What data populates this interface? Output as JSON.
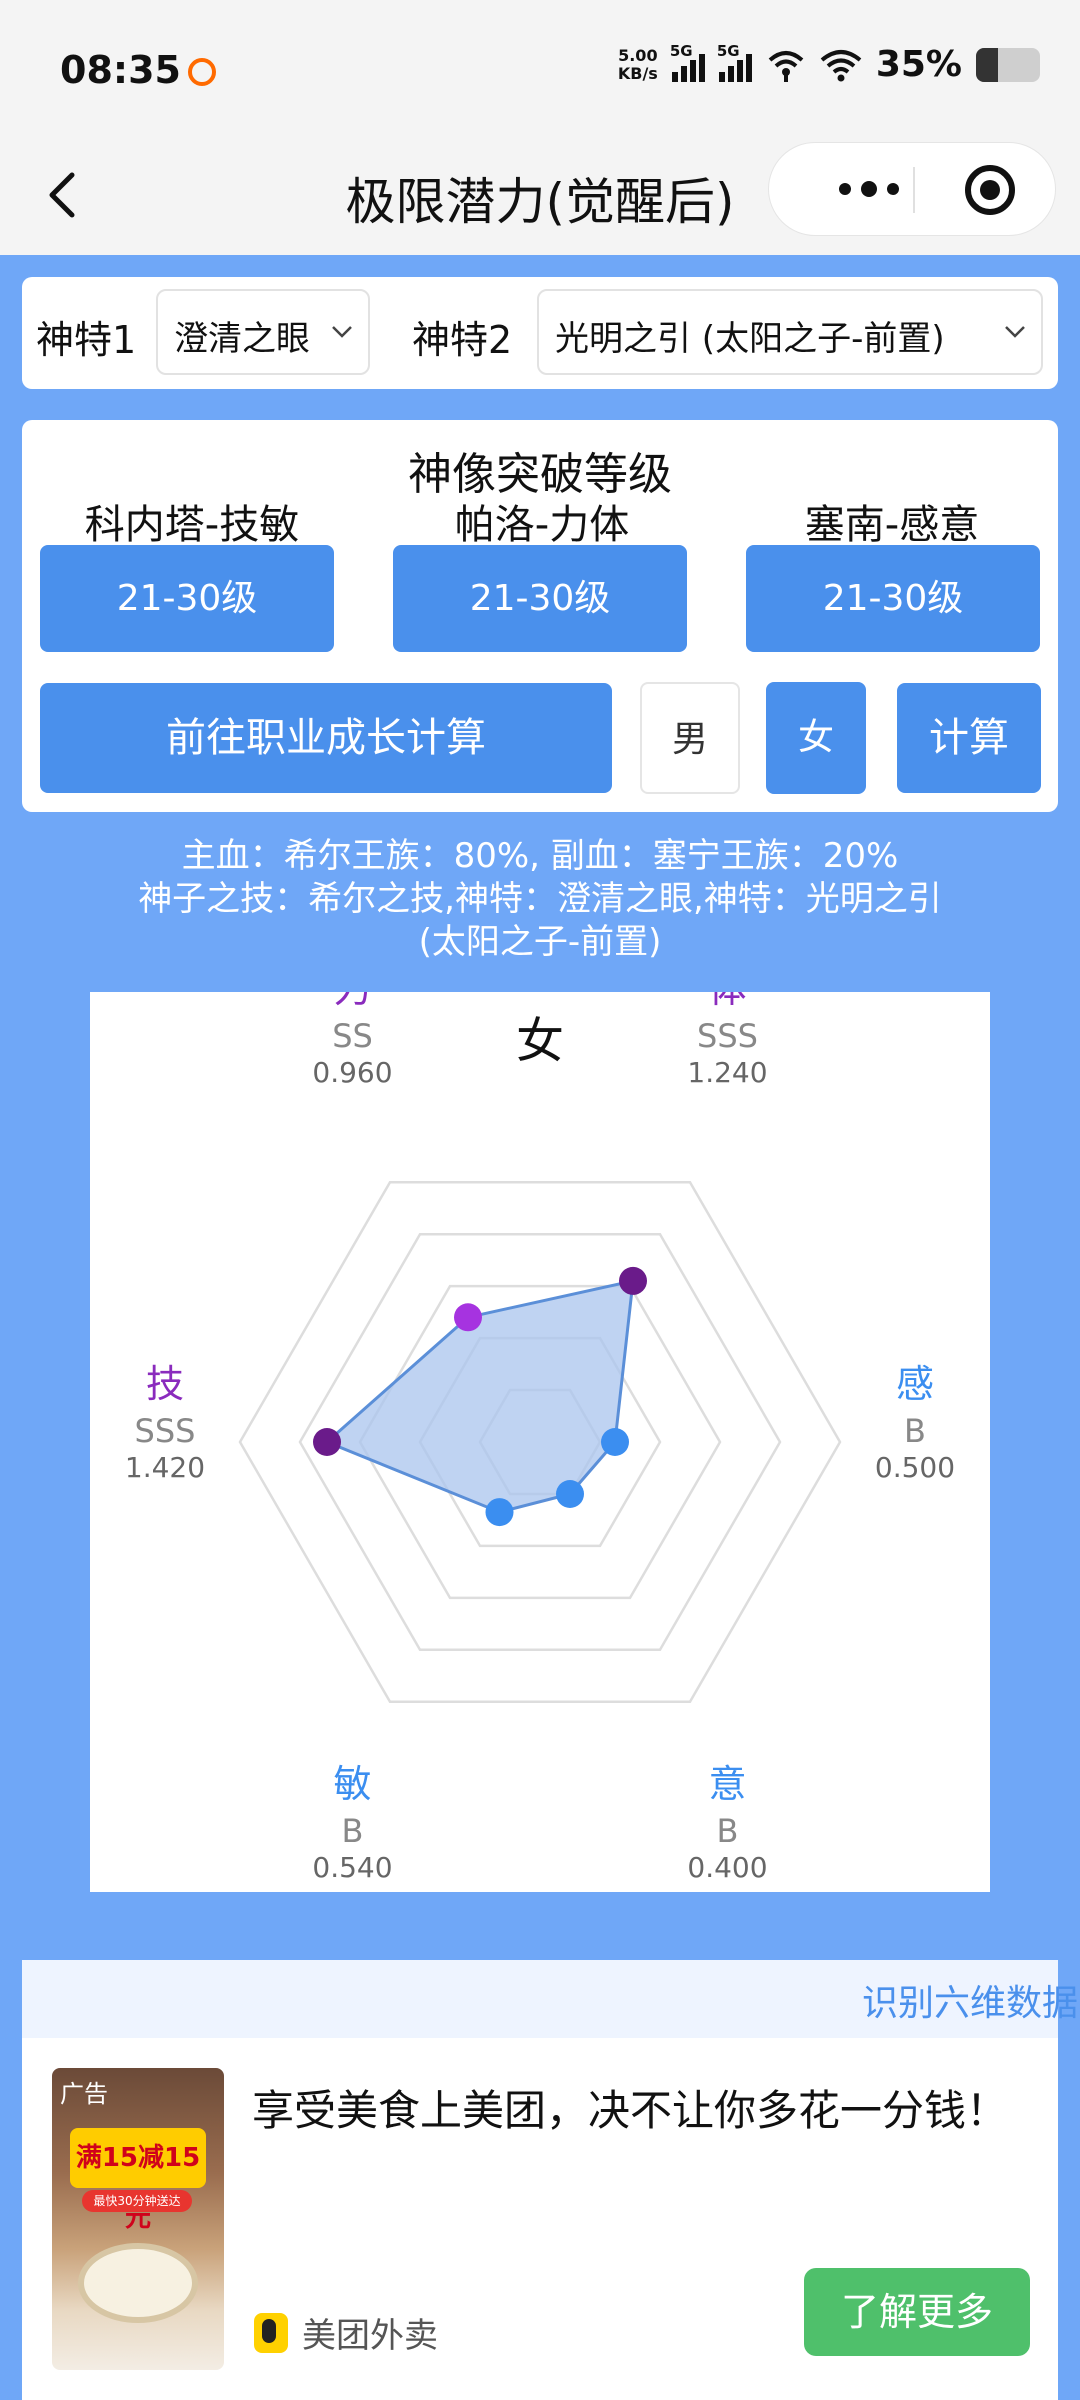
{
  "status": {
    "time": "08:35",
    "net_speed_value": "5.00",
    "net_speed_unit": "KB/s",
    "sig1": "5G",
    "sig2": "5G",
    "battery": "35%",
    "battery_level": 0.35
  },
  "nav": {
    "title": "极限潜力(觉醒后)"
  },
  "shente": {
    "label1": "神特1",
    "value1": "澄清之眼",
    "label2": "神特2",
    "value2": "光明之引 (太阳之子-前置)"
  },
  "breakthrough": {
    "title": "神像突破等级",
    "gods": [
      {
        "name": "科内塔-技敏",
        "level": "21-30级"
      },
      {
        "name": "帕洛-力体",
        "level": "21-30级"
      },
      {
        "name": "塞南-感意",
        "level": "21-30级"
      }
    ],
    "go_label": "前往职业成长计算",
    "male_label": "男",
    "female_label": "女",
    "calc_label": "计算"
  },
  "summary": {
    "line1": "主血：希尔王族：80%, 副血：塞宁王族：20%",
    "line2": "神子之技：希尔之技,神特：澄清之眼,神特：光明之引",
    "line3": "(太阳之子-前置)"
  },
  "chart_data": {
    "type": "radar",
    "title": "女",
    "axes": [
      {
        "name": "力",
        "grade": "SS",
        "value": 0.96,
        "value_text": "0.960"
      },
      {
        "name": "体",
        "grade": "SSS",
        "value": 1.24,
        "value_text": "1.240"
      },
      {
        "name": "感",
        "grade": "B",
        "value": 0.5,
        "value_text": "0.500"
      },
      {
        "name": "意",
        "grade": "B",
        "value": 0.4,
        "value_text": "0.400"
      },
      {
        "name": "敏",
        "grade": "B",
        "value": 0.54,
        "value_text": "0.540"
      },
      {
        "name": "技",
        "grade": "SSS",
        "value": 1.42,
        "value_text": "1.420"
      }
    ],
    "max": 2.0,
    "rings": 5,
    "colors": {
      "fill": "#a9c4ee",
      "stroke": "#5b8fd8",
      "point_strong": "#6a1b8a",
      "point_mid": "#a633e0",
      "point_weak": "#3b8ef0",
      "label_purple": "#8a2bbd",
      "label_blue": "#3b8ef0",
      "grid": "#dddddd"
    }
  },
  "recognize": {
    "label": "识别六维数据"
  },
  "ad": {
    "tag": "广告",
    "promo": "满15减15元",
    "promo_sub": "最快30分钟送达",
    "text": "享受美食上美团，决不让你多花一分钱！",
    "brand": "美团外卖",
    "button": "了解更多"
  }
}
